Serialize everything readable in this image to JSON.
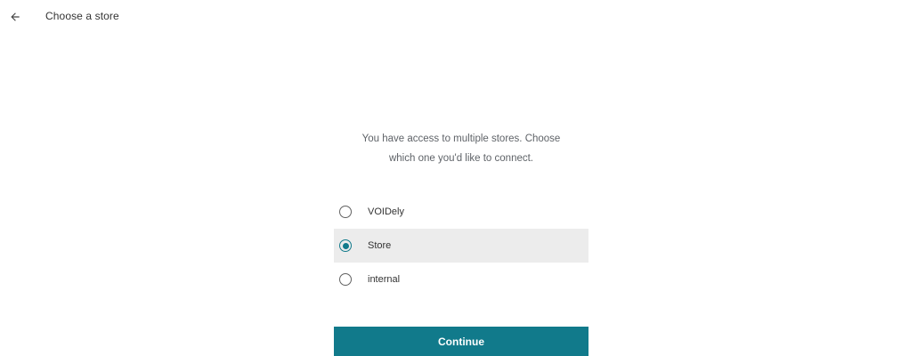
{
  "header": {
    "back_icon": "arrow-left-icon",
    "title": "Choose a store"
  },
  "intro": {
    "line1": "You have access to multiple stores. Choose",
    "line2": "which one you'd like to connect."
  },
  "stores": [
    {
      "label": "VOIDely",
      "selected": false
    },
    {
      "label": "Store",
      "selected": true
    },
    {
      "label": "internal",
      "selected": false
    }
  ],
  "continue_label": "Continue",
  "colors": {
    "accent": "#117a8b",
    "selected_row": "#ececec"
  }
}
